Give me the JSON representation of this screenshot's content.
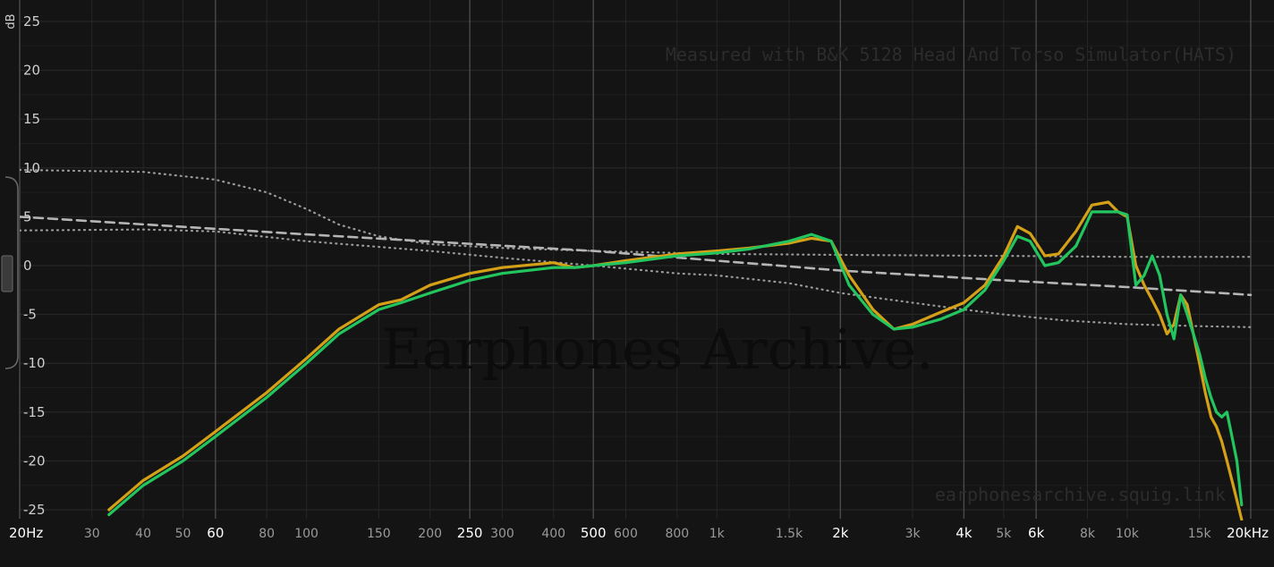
{
  "chart_data": {
    "type": "line",
    "xscale": "log",
    "xlim": [
      20,
      20000
    ],
    "ylim": [
      -25,
      25
    ],
    "yunit": "dB",
    "grid": true,
    "yticks": [
      25,
      20,
      15,
      10,
      5,
      0,
      -5,
      -10,
      -15,
      -20,
      -25
    ],
    "xticks": [
      {
        "value": 20,
        "label": "20Hz",
        "major": true
      },
      {
        "value": 30,
        "label": "30",
        "major": false
      },
      {
        "value": 40,
        "label": "40",
        "major": false
      },
      {
        "value": 50,
        "label": "50",
        "major": false
      },
      {
        "value": 60,
        "label": "60",
        "major": true
      },
      {
        "value": 80,
        "label": "80",
        "major": false
      },
      {
        "value": 100,
        "label": "100",
        "major": false
      },
      {
        "value": 150,
        "label": "150",
        "major": false
      },
      {
        "value": 200,
        "label": "200",
        "major": false
      },
      {
        "value": 250,
        "label": "250",
        "major": true
      },
      {
        "value": 300,
        "label": "300",
        "major": false
      },
      {
        "value": 400,
        "label": "400",
        "major": false
      },
      {
        "value": 500,
        "label": "500",
        "major": true
      },
      {
        "value": 600,
        "label": "600",
        "major": false
      },
      {
        "value": 800,
        "label": "800",
        "major": false
      },
      {
        "value": 1000,
        "label": "1k",
        "major": false
      },
      {
        "value": 1500,
        "label": "1.5k",
        "major": false
      },
      {
        "value": 2000,
        "label": "2k",
        "major": true
      },
      {
        "value": 3000,
        "label": "3k",
        "major": false
      },
      {
        "value": 4000,
        "label": "4k",
        "major": true
      },
      {
        "value": 5000,
        "label": "5k",
        "major": false
      },
      {
        "value": 6000,
        "label": "6k",
        "major": true
      },
      {
        "value": 8000,
        "label": "8k",
        "major": false
      },
      {
        "value": 10000,
        "label": "10k",
        "major": false
      },
      {
        "value": 15000,
        "label": "15k",
        "major": false
      },
      {
        "value": 20000,
        "label": "20kHz",
        "major": true
      }
    ],
    "annotations": [
      "Measured with B&K 5128 Head And Torso Simulator(HATS)",
      "Earphones Archive.",
      "earphonesarchive.squig.link"
    ],
    "series": [
      {
        "color": "#d4a017",
        "style": "solid",
        "x": [
          33,
          40,
          50,
          60,
          80,
          100,
          120,
          150,
          170,
          200,
          250,
          300,
          400,
          450,
          500,
          600,
          800,
          1000,
          1200,
          1500,
          1700,
          1900,
          2100,
          2400,
          2700,
          3000,
          3500,
          4000,
          4500,
          5000,
          5400,
          5800,
          6300,
          6800,
          7500,
          8200,
          9000,
          9500,
          10000,
          10500,
          11000,
          11500,
          12000,
          12500,
          13000,
          13500,
          14000,
          14500,
          15000,
          15500,
          16000,
          16500,
          17000,
          17500,
          18000,
          18500,
          19000
        ],
        "y": [
          -25,
          -22,
          -19.5,
          -17,
          -13,
          -9.5,
          -6.5,
          -4,
          -3.5,
          -2,
          -0.8,
          -0.2,
          0.3,
          -0.2,
          0,
          0.5,
          1.2,
          1.5,
          1.8,
          2.3,
          2.8,
          2.5,
          -1,
          -4.5,
          -6.5,
          -6,
          -4.8,
          -3.8,
          -2,
          1,
          4,
          3.3,
          1,
          1.2,
          3.5,
          6.2,
          6.5,
          5.5,
          5,
          0,
          -2,
          -3.5,
          -5,
          -7,
          -6,
          -3,
          -4,
          -7,
          -10,
          -13,
          -15.5,
          -16.5,
          -18,
          -20,
          -22,
          -24,
          -26
        ]
      },
      {
        "color": "#22c55e",
        "style": "solid",
        "x": [
          33,
          40,
          50,
          60,
          80,
          100,
          120,
          150,
          170,
          200,
          250,
          300,
          400,
          450,
          500,
          600,
          800,
          1000,
          1200,
          1500,
          1700,
          1900,
          2100,
          2400,
          2700,
          3000,
          3500,
          4000,
          4500,
          5000,
          5400,
          5800,
          6300,
          6800,
          7500,
          8200,
          9000,
          9500,
          10000,
          10500,
          11000,
          11500,
          12000,
          12500,
          13000,
          13500,
          14000,
          14500,
          15000,
          15500,
          16000,
          16500,
          17000,
          17500,
          18000,
          18500,
          19000
        ],
        "y": [
          -25.5,
          -22.5,
          -20,
          -17.5,
          -13.5,
          -10,
          -7,
          -4.5,
          -3.8,
          -2.8,
          -1.5,
          -0.8,
          -0.2,
          -0.2,
          0,
          0.3,
          1.0,
          1.3,
          1.7,
          2.5,
          3.2,
          2.5,
          -2,
          -5,
          -6.5,
          -6.3,
          -5.5,
          -4.5,
          -2.5,
          0.5,
          3,
          2.5,
          0,
          0.3,
          2,
          5.5,
          5.5,
          5.5,
          5.2,
          -2,
          -1,
          1,
          -1,
          -5,
          -7.5,
          -3,
          -5,
          -7,
          -9,
          -11.5,
          -13.5,
          -15,
          -15.5,
          -15,
          -17.5,
          -20,
          -24.5
        ]
      },
      {
        "color": "#b5b5b5",
        "style": "dashed",
        "x": [
          20,
          100,
          500,
          1000,
          2000,
          5000,
          10000,
          20000
        ],
        "y": [
          5,
          3.2,
          1.5,
          0.5,
          -0.5,
          -1.5,
          -2.2,
          -3.0
        ]
      },
      {
        "color": "#9a9a9a",
        "style": "dotted",
        "x": [
          20,
          40,
          60,
          80,
          100,
          120,
          150,
          200,
          300,
          500,
          1000,
          2000,
          5000,
          10000,
          20000
        ],
        "y": [
          9.8,
          9.6,
          8.8,
          7.5,
          5.8,
          4.2,
          3.0,
          2.2,
          1.8,
          1.5,
          1.2,
          1.1,
          1.0,
          0.9,
          0.9
        ]
      },
      {
        "color": "#9a9a9a",
        "style": "dotted",
        "x": [
          20,
          40,
          60,
          100,
          200,
          300,
          500,
          800,
          1000,
          1500,
          2000,
          3000,
          4000,
          5000,
          7000,
          10000,
          15000,
          20000
        ],
        "y": [
          3.6,
          3.7,
          3.5,
          2.5,
          1.5,
          0.8,
          0,
          -0.8,
          -1.0,
          -1.8,
          -2.8,
          -3.8,
          -4.5,
          -5.0,
          -5.6,
          -6.0,
          -6.2,
          -6.3
        ]
      }
    ]
  }
}
